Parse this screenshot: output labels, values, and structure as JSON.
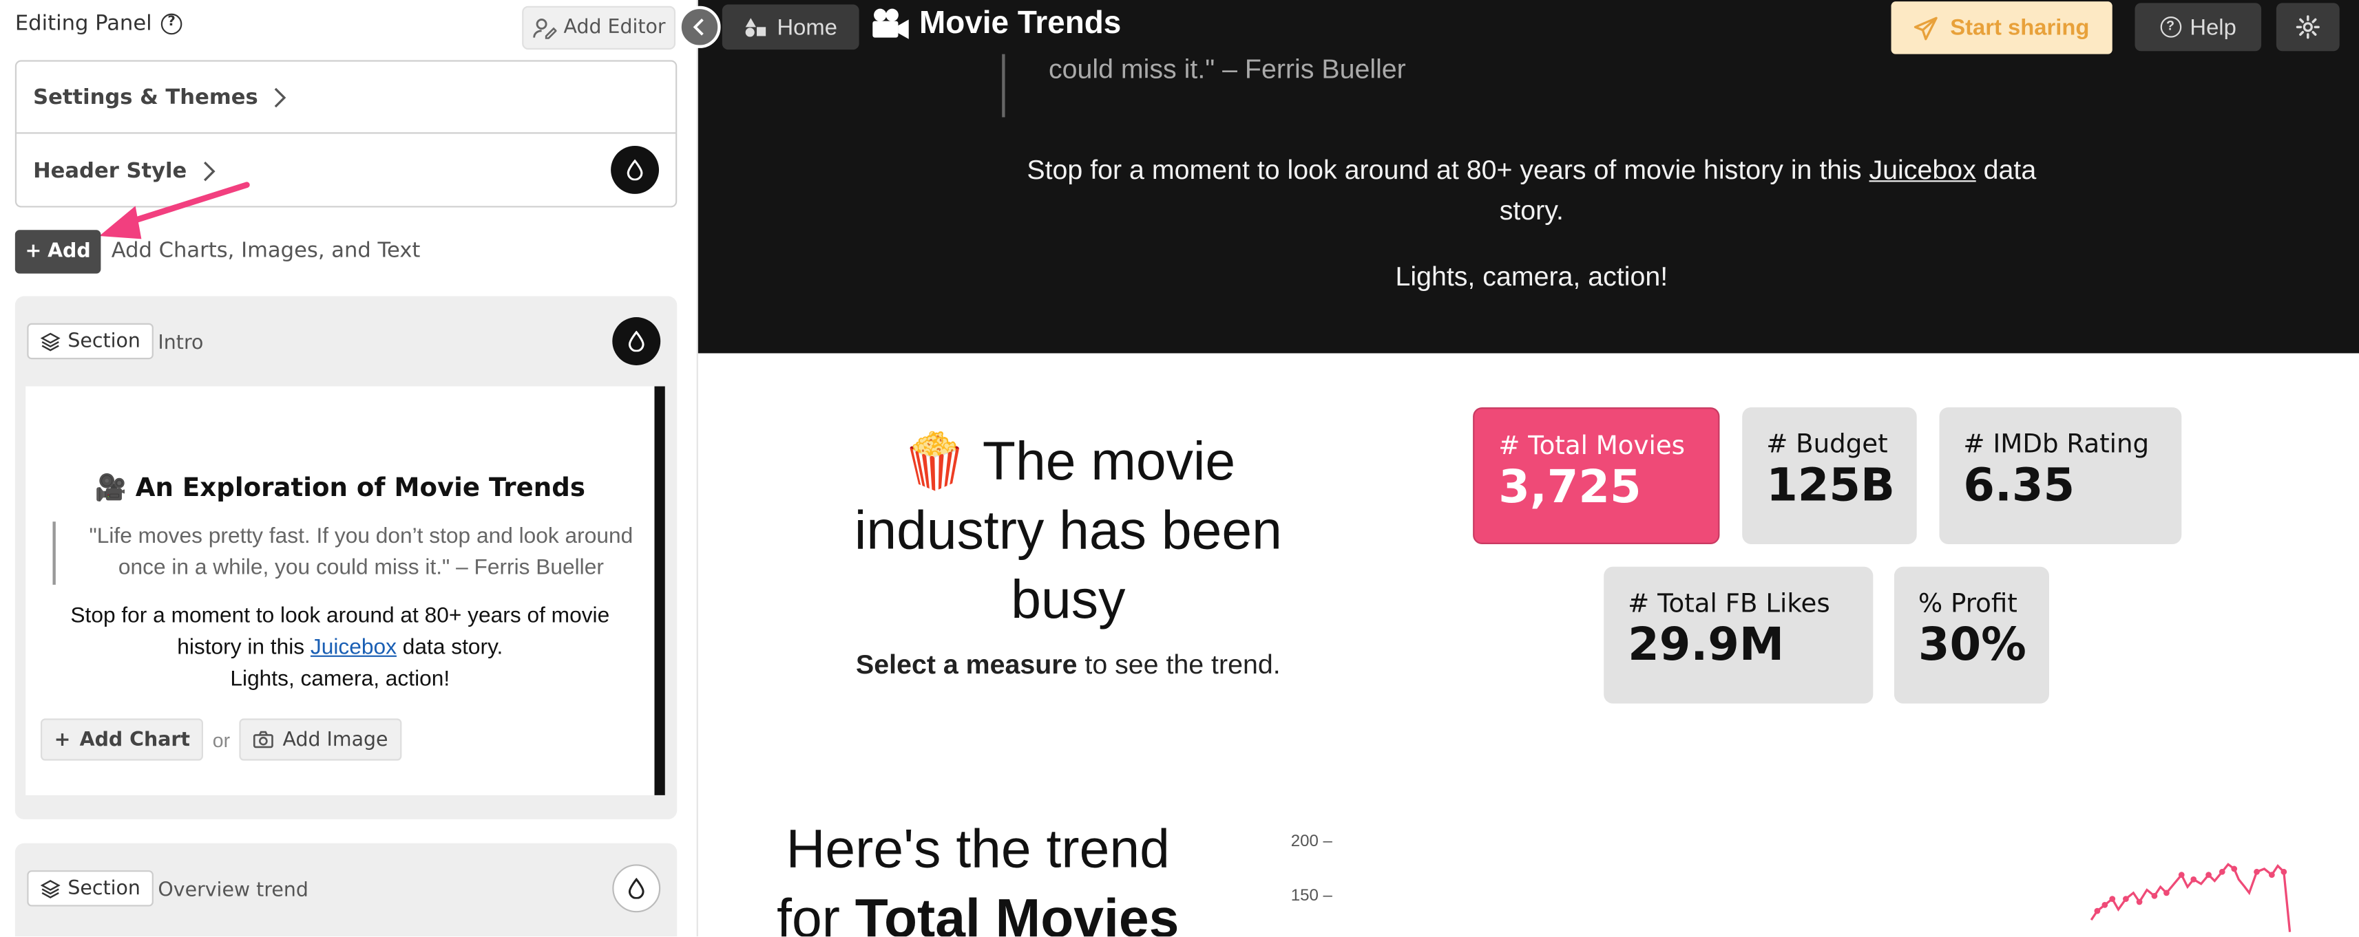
{
  "editor": {
    "title": "Editing Panel",
    "add_editor_label": "Add Editor",
    "accordion": [
      {
        "label": "Settings & Themes"
      },
      {
        "label": "Header Style"
      }
    ],
    "add_label": "Add",
    "add_hint": "Add Charts, Images, and Text",
    "sections": [
      {
        "tag": "Section",
        "name": "Intro",
        "preview": {
          "title": "🎥 An Exploration of Movie Trends",
          "quote": "\"Life moves pretty fast. If you don’t stop and look around once in a while, you could miss it.\" – Ferris Bueller",
          "body_before": "Stop for a moment to look around at 80+ years of movie history in this ",
          "body_link": "Juicebox",
          "body_after": " data story.",
          "body_line2": "Lights, camera, action!",
          "add_chart_label": "Add Chart",
          "or_label": "or",
          "add_image_label": "Add Image"
        }
      },
      {
        "tag": "Section",
        "name": "Overview trend"
      }
    ]
  },
  "story": {
    "home_label": "Home",
    "title": "Movie Trends",
    "share_label": "Start sharing",
    "help_label": "Help",
    "hero_quote_tail": "could miss it.\" – Ferris Bueller",
    "hero_before": "Stop for a moment to look around at 80+ years of movie history in this ",
    "hero_link": "Juicebox",
    "hero_after": " data story.",
    "hero_line2": "Lights, camera, action!",
    "headline": "🍿 The movie industry has been busy",
    "sub_bold": "Select a measure",
    "sub_rest": " to see the trend.",
    "metrics": [
      {
        "label": "# Total Movies",
        "value": "3,725",
        "active": true
      },
      {
        "label": "# Budget",
        "value": "125B",
        "active": false
      },
      {
        "label": "# IMDb Rating",
        "value": "6.35",
        "active": false
      },
      {
        "label": "# Total FB Likes",
        "value": "29.9M",
        "active": false
      },
      {
        "label": "% Profit",
        "value": "30%",
        "active": false
      }
    ],
    "trend_prefix": "Here's the trend",
    "trend_for": "for ",
    "trend_measure": "Total Movies",
    "y_ticks": [
      "200 –",
      "150 –"
    ],
    "accent_color": "#ef4a77"
  }
}
